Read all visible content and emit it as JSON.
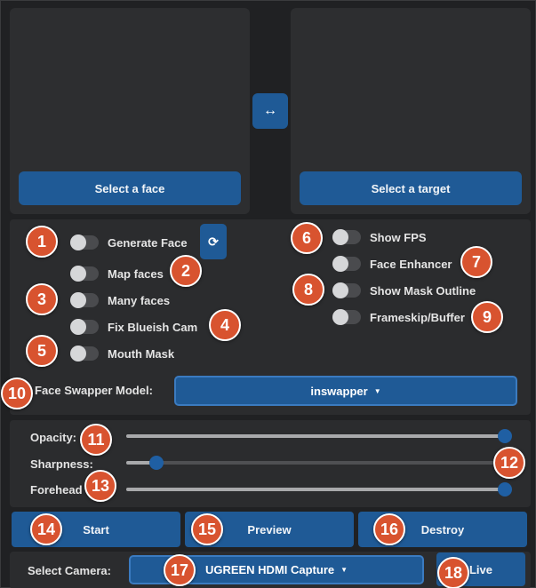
{
  "source": {
    "button_label": "Select a face"
  },
  "target": {
    "button_label": "Select a target"
  },
  "swap_icon": "↔",
  "refresh_icon": "⟳",
  "options_left": [
    {
      "label": "Generate Face"
    },
    {
      "label": "Map faces"
    },
    {
      "label": "Many faces"
    },
    {
      "label": "Fix Blueish Cam"
    },
    {
      "label": "Mouth Mask"
    }
  ],
  "options_right": [
    {
      "label": "Show FPS"
    },
    {
      "label": "Face Enhancer"
    },
    {
      "label": "Show Mask Outline"
    },
    {
      "label": "Frameskip/Buffer"
    }
  ],
  "model": {
    "label": "Face Swapper Model:",
    "value": "inswapper",
    "arrow": "▼"
  },
  "sliders": [
    {
      "label": "Opacity:",
      "value": 1.0
    },
    {
      "label": "Sharpness:",
      "value": 0.08
    },
    {
      "label": "Forehead",
      "value": 1.0
    }
  ],
  "actions": {
    "start": "Start",
    "preview": "Preview",
    "destroy": "Destroy"
  },
  "camera": {
    "label": "Select Camera:",
    "value": "UGREEN HDMI Capture",
    "arrow": "▼",
    "live": "Live"
  },
  "badges": [
    "1",
    "2",
    "3",
    "4",
    "5",
    "6",
    "7",
    "8",
    "9",
    "10",
    "11",
    "12",
    "13",
    "14",
    "15",
    "16",
    "17",
    "18"
  ],
  "colors": {
    "accent": "#1f5a96",
    "badge": "#d8532f",
    "panel": "#2b2c2e"
  }
}
